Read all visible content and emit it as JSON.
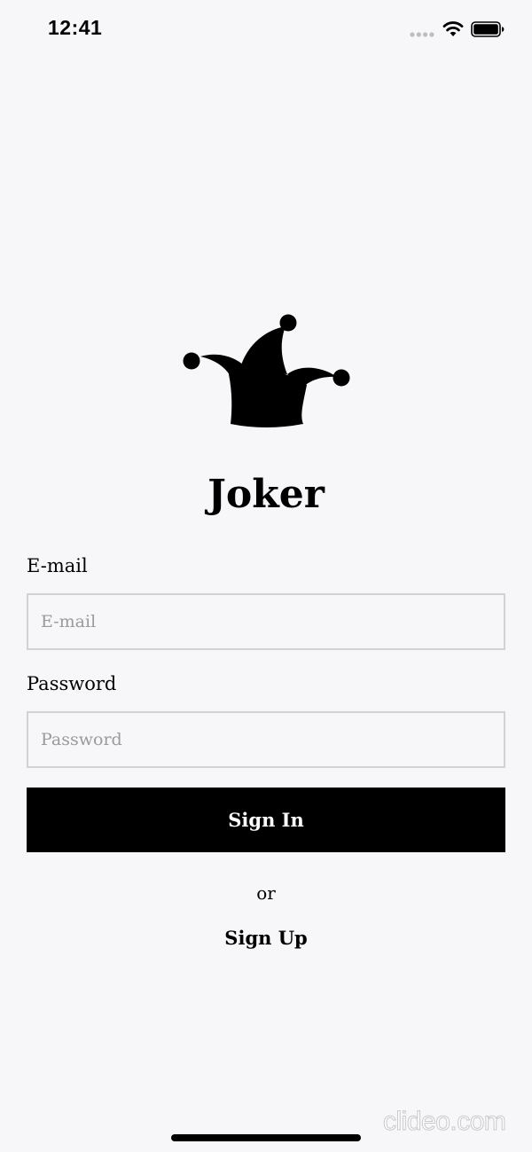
{
  "status_bar": {
    "time": "12:41",
    "icons": [
      "signal-dots-icon",
      "wifi-icon",
      "battery-icon"
    ]
  },
  "app": {
    "logo_icon": "jester-hat-icon",
    "title": "Joker"
  },
  "form": {
    "email_label": "E-mail",
    "email_placeholder": "E-mail",
    "email_value": "",
    "password_label": "Password",
    "password_placeholder": "Password",
    "password_value": "",
    "sign_in_label": "Sign In",
    "or_text": "or",
    "sign_up_label": "Sign Up"
  },
  "watermark": "clideo.com",
  "colors": {
    "background": "#f7f6f8",
    "primary": "#000000",
    "input_border": "#d2d2d4",
    "placeholder": "#9a9a9c"
  }
}
